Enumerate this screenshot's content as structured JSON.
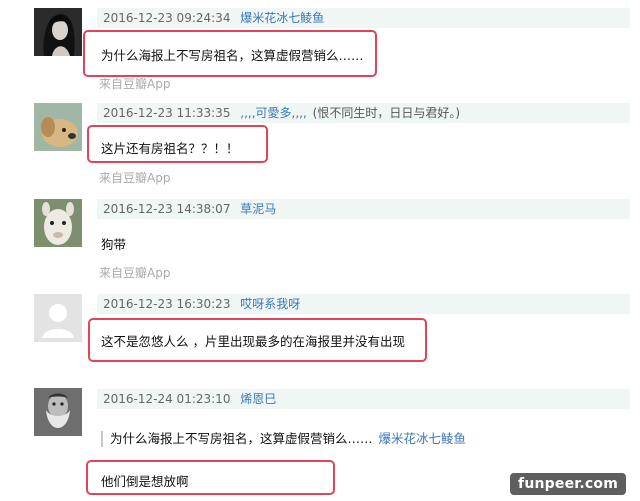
{
  "comments": [
    {
      "time": "2016-12-23 09:24:34",
      "user": "爆米花冰七鲮鱼",
      "signature": "",
      "text": "为什么海报上不写房祖名，这算虚假营销么……",
      "source": "来自豆瓣App",
      "avatar": "woman-portrait-avatar"
    },
    {
      "time": "2016-12-23 11:33:35",
      "user": ",,,,可愛多,,,,",
      "signature": "(恨不同生时，日日与君好。)",
      "text": "这片还有房祖名？？！！",
      "source": "来自豆瓣App",
      "avatar": "dog-avatar"
    },
    {
      "time": "2016-12-23 14:38:07",
      "user": "草泥马",
      "signature": "",
      "text": "狗带",
      "source": "来自豆瓣App",
      "avatar": "alpaca-avatar"
    },
    {
      "time": "2016-12-23 16:30:23",
      "user": "哎呀系我呀",
      "signature": "",
      "text": "这不是忽悠人么 ，片里出现最多的在海报里并没有出现",
      "source": "",
      "avatar": "default-user-avatar"
    },
    {
      "time": "2016-12-24 01:23:10",
      "user": "烯恩巳",
      "signature": "",
      "text": "他们倒是想放啊",
      "source": "",
      "avatar": "bearded-man-avatar",
      "quote": {
        "text": "为什么海报上不写房祖名，这算虚假营销么……",
        "author": "爆米花冰七鲮鱼"
      }
    }
  ],
  "watermark": "funpeer.com",
  "colors": {
    "highlight": "#e0435a",
    "link": "#3a77bd",
    "meta_bg": "#f0f6f3"
  }
}
